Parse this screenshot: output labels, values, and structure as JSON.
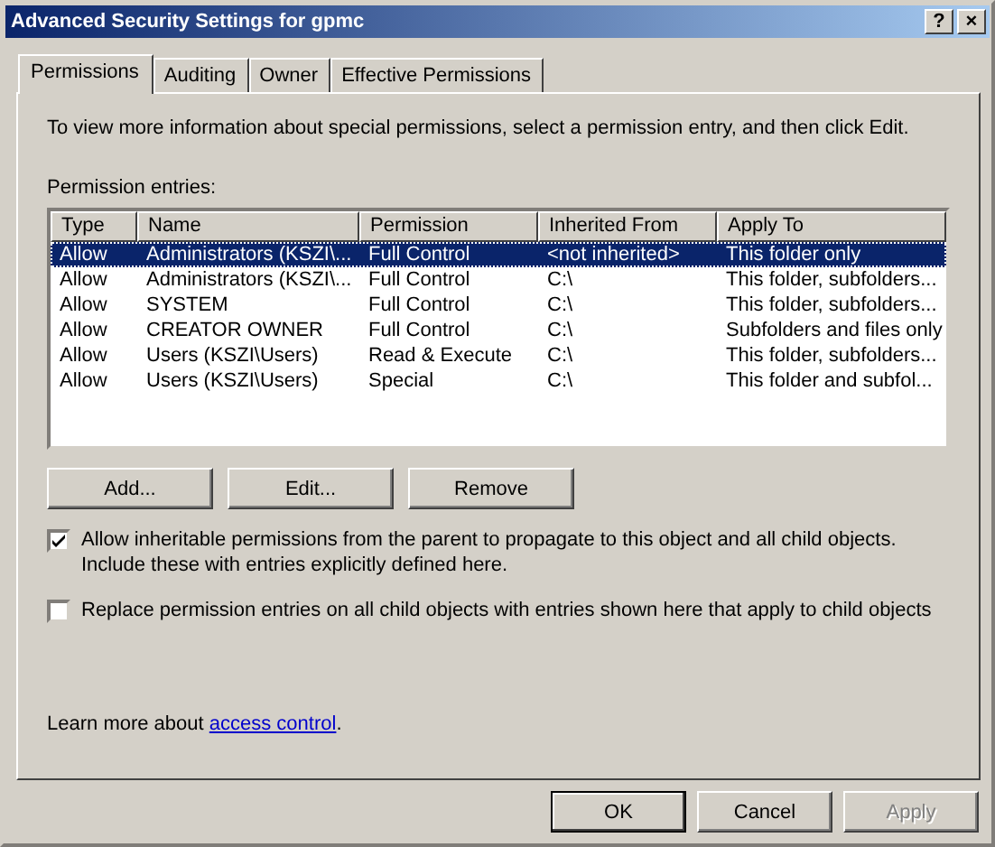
{
  "window": {
    "title": "Advanced Security Settings for gpmc",
    "help_button": "?",
    "close_button": "×"
  },
  "tabs": [
    {
      "label": "Permissions",
      "selected": true
    },
    {
      "label": "Auditing",
      "selected": false
    },
    {
      "label": "Owner",
      "selected": false
    },
    {
      "label": "Effective Permissions",
      "selected": false
    }
  ],
  "intro": "To view more information about special permissions, select a permission entry, and then click Edit.",
  "entries_label": "Permission entries:",
  "table": {
    "columns": [
      "Type",
      "Name",
      "Permission",
      "Inherited From",
      "Apply To"
    ],
    "rows": [
      {
        "cells": [
          "Allow",
          "Administrators (KSZI\\...",
          "Full Control",
          "<not inherited>",
          "This folder only"
        ],
        "selected": true
      },
      {
        "cells": [
          "Allow",
          "Administrators (KSZI\\...",
          "Full Control",
          "C:\\",
          "This folder, subfolders..."
        ],
        "selected": false
      },
      {
        "cells": [
          "Allow",
          "SYSTEM",
          "Full Control",
          "C:\\",
          "This folder, subfolders..."
        ],
        "selected": false
      },
      {
        "cells": [
          "Allow",
          "CREATOR OWNER",
          "Full Control",
          "C:\\",
          "Subfolders and files only"
        ],
        "selected": false
      },
      {
        "cells": [
          "Allow",
          "Users (KSZI\\Users)",
          "Read & Execute",
          "C:\\",
          "This folder, subfolders..."
        ],
        "selected": false
      },
      {
        "cells": [
          "Allow",
          "Users (KSZI\\Users)",
          "Special",
          "C:\\",
          "This folder and subfol..."
        ],
        "selected": false
      }
    ]
  },
  "entry_buttons": [
    "Add...",
    "Edit...",
    "Remove"
  ],
  "options": [
    {
      "label": "Allow inheritable permissions from the parent to propagate to this object and all child objects. Include these with entries explicitly defined here.",
      "checked": true
    },
    {
      "label": "Replace permission entries on all child objects with entries shown here that apply to child objects",
      "checked": false
    }
  ],
  "learn_more": {
    "text": "Learn more about ",
    "link": "access control",
    "after": "."
  },
  "dialog_buttons": [
    {
      "label": "OK",
      "disabled": false,
      "default": true
    },
    {
      "label": "Cancel",
      "disabled": false,
      "default": false
    },
    {
      "label": "Apply",
      "disabled": true,
      "default": false
    }
  ]
}
